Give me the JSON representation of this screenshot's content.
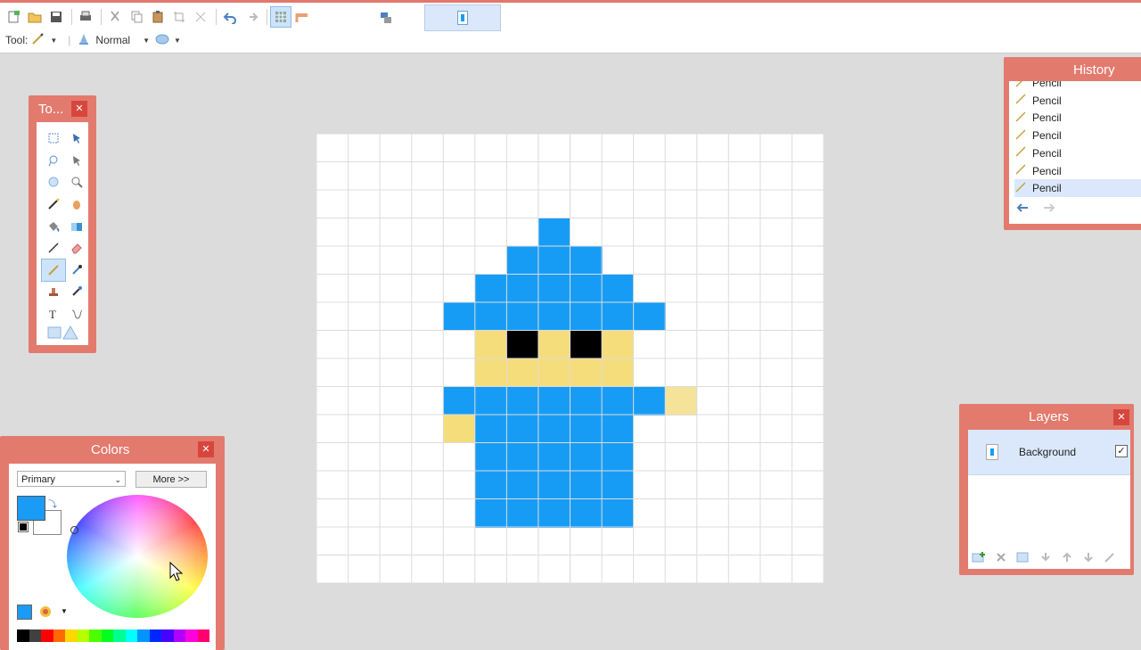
{
  "toolbar": {
    "tool_label": "Tool:",
    "blend_label": "Normal"
  },
  "tools_panel": {
    "title": "To..."
  },
  "history_panel": {
    "title": "History",
    "items": [
      "Pencil",
      "Pencil",
      "Pencil",
      "Pencil",
      "Pencil",
      "Pencil",
      "Pencil"
    ]
  },
  "colors_panel": {
    "title": "Colors",
    "mode": "Primary",
    "more_label": "More >>",
    "primary_color": "#1a9bf5",
    "secondary_color": "#ffffff"
  },
  "layers_panel": {
    "title": "Layers",
    "layers": [
      {
        "name": "Background",
        "visible": true
      }
    ]
  },
  "canvas": {
    "background": "#ffffff",
    "colors": {
      "B": "#179cf6",
      "Y": "#f6dd7b",
      "K": "#000000",
      "y": "#f6e39a"
    },
    "pixels": [
      "................",
      "................",
      "................",
      "....... B........",
      "......BBB.......",
      ".....BBBBB......",
      "....BBBBBBB.....",
      ".....YKYKY......",
      ".....YYYYY......",
      "....BBBBBBBy....",
      "....YBBBBB......",
      ".....BBBBB......",
      ".....BBBBB......",
      ".....BBBBB......",
      "................",
      "................"
    ]
  }
}
